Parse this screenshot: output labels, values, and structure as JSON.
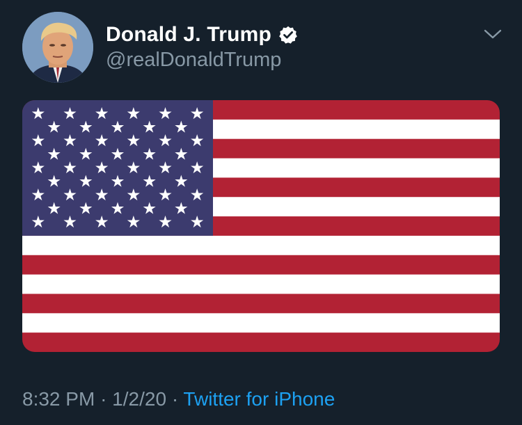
{
  "tweet": {
    "author": {
      "display_name": "Donald J. Trump",
      "handle": "@realDonaldTrump",
      "verified": true,
      "avatar": "profile-photo"
    },
    "media": {
      "type": "image",
      "subject": "american-flag",
      "stripes": 13,
      "star_rows": 9,
      "colors": {
        "red": "#b22234",
        "white": "#ffffff",
        "blue": "#3c3b6e"
      }
    },
    "time": "8:32 PM",
    "separator": "·",
    "date": "1/2/20",
    "source": "Twitter for iPhone"
  },
  "theme": {
    "background": "#15202b",
    "primary_text": "#ffffff",
    "secondary_text": "#8899a6",
    "accent": "#1da1f2"
  },
  "icons": {
    "verified": "verified-badge-icon",
    "menu": "chevron-down-icon"
  }
}
